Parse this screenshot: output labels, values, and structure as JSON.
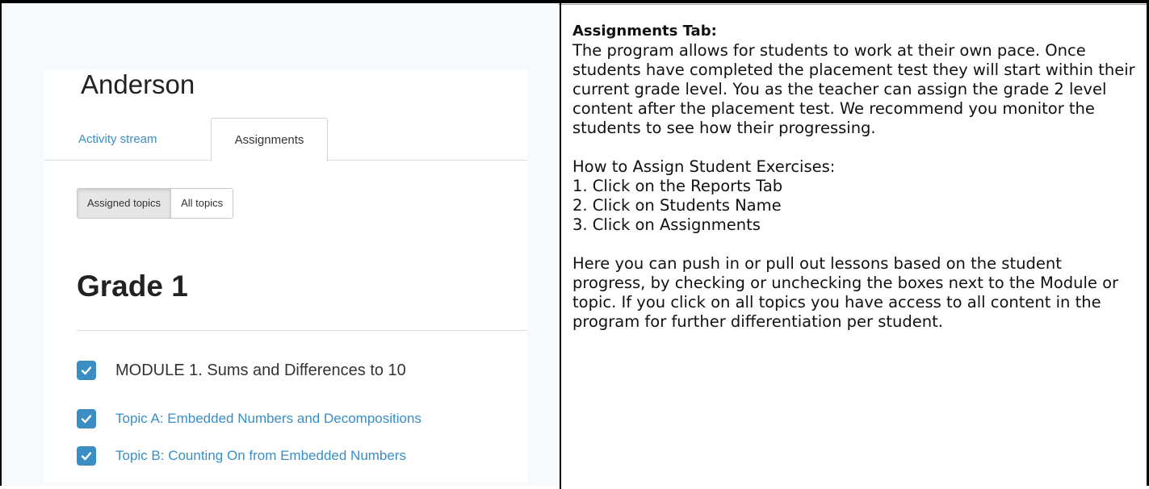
{
  "left_panel": {
    "student_name": "Anderson",
    "tabs": [
      {
        "label": "Activity stream",
        "active": false
      },
      {
        "label": "Assignments",
        "active": true
      }
    ],
    "topic_filter": {
      "options": [
        {
          "label": "Assigned topics",
          "active": true
        },
        {
          "label": "All topics",
          "active": false
        }
      ]
    },
    "grade_title": "Grade 1",
    "items": [
      {
        "type": "module",
        "label": "MODULE 1. Sums and Differences to 10",
        "checked": true
      },
      {
        "type": "topic",
        "label": "Topic A: Embedded Numbers and Decompositions",
        "checked": true
      },
      {
        "type": "topic",
        "label": "Topic B: Counting On from Embedded Numbers",
        "checked": true
      }
    ],
    "accent_color": "#3b8ec4"
  },
  "right_panel": {
    "heading": "Assignments Tab:",
    "intro": "The program allows for students to work at their own pace. Once students have completed the placement test they will start within their current grade level. You as the teacher can assign the grade 2 level content after the placement test. We recommend you monitor the students to see how their progressing.",
    "howto_heading": "How to Assign Student Exercises:",
    "steps": [
      "1.  Click on the Reports Tab",
      "2.  Click on Students Name",
      "3.  Click on Assignments"
    ],
    "closing": "Here you can push in or pull out lessons based on the student progress, by checking or unchecking the boxes next to the Module or topic.  If you click on all topics you have access to all content in the program for further differentiation per student."
  }
}
